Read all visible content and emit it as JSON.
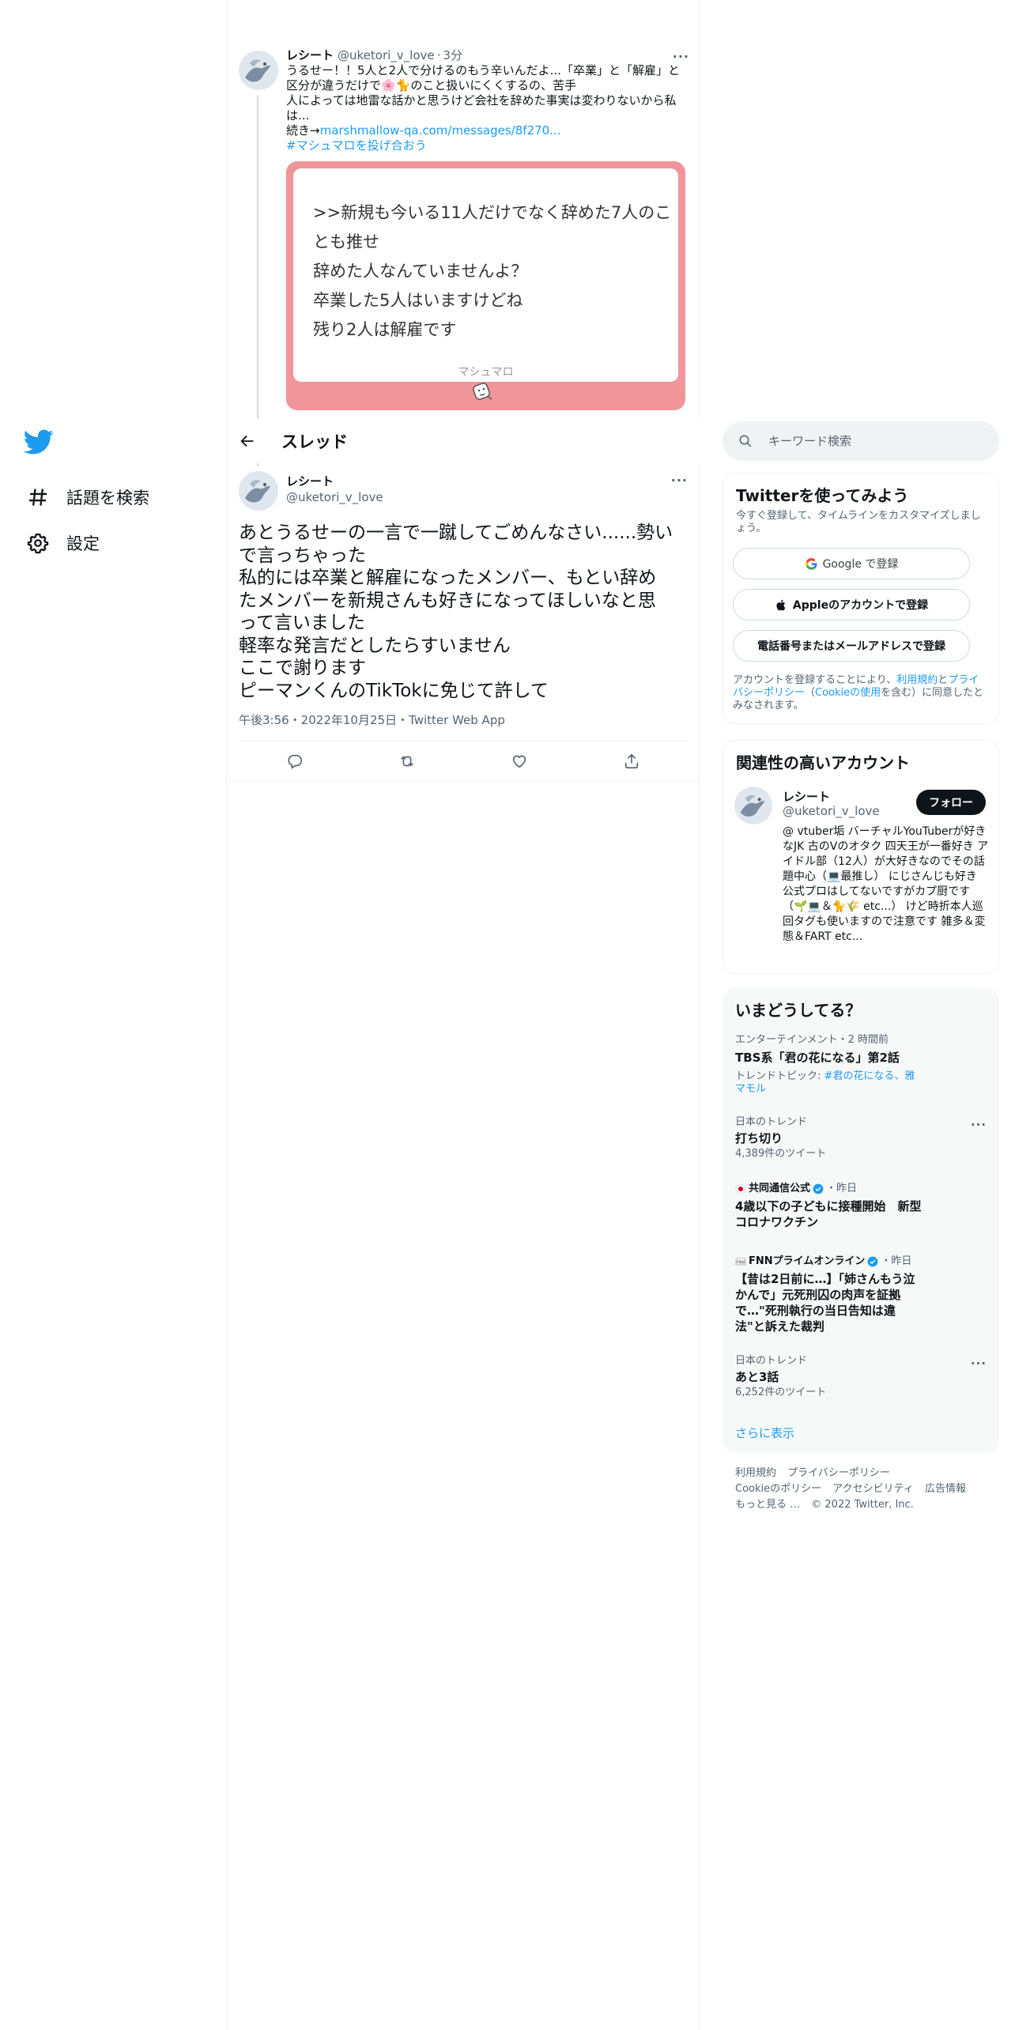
{
  "nav": {
    "items": [
      {
        "label": "話題を検索",
        "icon": "hashtag-icon"
      },
      {
        "label": "設定",
        "icon": "gear-icon"
      }
    ]
  },
  "prev_tweet": {
    "name": "レシート",
    "handle": "@uketori_v_love",
    "time": "3分",
    "text_lines": [
      "うるせー！！5人と2人で分けるのもう辛いんだよ...「卒業」と「解雇」と",
      "区分が違うだけで🌸🐈のこと扱いにくくするの、苦手",
      "人によっては地雷な話かと思うけど会社を辞めた事実は変わりないから私",
      "は..."
    ],
    "link_prefix": "続き→",
    "link": "marshmallow-qa.com/messages/8f270...",
    "hashtag": "#マシュマロを投げ合おう",
    "card": {
      "lines": [
        ">>新規も今いる11人だけでなく辞めた7人のこ",
        "とも推せ",
        "辞めた人なんていませんよ？",
        "卒業した5人はいますけどね",
        "残り2人は解雇です"
      ],
      "footer": "マシュマロ"
    }
  },
  "thread_header": {
    "title": "スレッド"
  },
  "main_tweet": {
    "name": "レシート",
    "handle": "@uketori_v_love",
    "text_lines": [
      "あとうるせーの一言で一蹴してごめんなさい......勢い",
      "で言っちゃった",
      "私的には卒業と解雇になったメンバー、もとい辞め",
      "たメンバーを新規さんも好きになってほしいなと思",
      "って言いました",
      "軽率な発言だとしたらすいません",
      "ここで謝ります",
      "ピーマンくんのTikTokに免じて許して"
    ],
    "meta": "午後3:56・2022年10月25日・Twitter Web App",
    "actions": [
      "reply-icon",
      "retweet-icon",
      "like-icon",
      "share-icon"
    ]
  },
  "search": {
    "placeholder": "キーワード検索"
  },
  "signup": {
    "title": "Twitterを使ってみよう",
    "subtitle": "今すぐ登録して、タイムラインをカスタマイズしましょう。",
    "google": "Google で登録",
    "apple": "Appleのアカウントで登録",
    "phone": "電話番号またはメールアドレスで登録",
    "legal_a": "アカウントを登録することにより、",
    "legal_terms": "利用規約",
    "legal_b": "と",
    "legal_privacy": "プライバシーポリシー",
    "legal_c": "（",
    "legal_cookie": "Cookieの使用",
    "legal_d": "を含む）に同意したとみなされます。"
  },
  "related": {
    "title": "関連性の高いアカウント",
    "name": "レシート",
    "handle": "@uketori_v_love",
    "follow": "フォロー",
    "bio": "@ vtuber垢 バーチャルYouTuberが好きなJK 古のVのオタク 四天王が一番好き アイドル部（12人）が大好きなのでその話題中心（💻最推し） にじさんじも好き 公式プロはしてないですがカプ厨です（🌱💻＆🐈🌾 etc...） けど時折本人巡回タグも使いますので注意です 雑多＆変態＆FART etc..."
  },
  "trends": {
    "title": "いまどうしてる？",
    "items": [
      {
        "context": "エンターテインメント・2 時間前",
        "title": "TBS系「君の花になる」第2話",
        "meta_prefix": "トレンドトピック: ",
        "meta_link": "#君の花になる、雅マモル"
      },
      {
        "context": "日本のトレンド",
        "title": "打ち切り",
        "meta": "4,389件のツイート"
      },
      {
        "source": "共同通信公式",
        "time": "・昨日",
        "title": "4歳以下の子どもに接種開始　新型コロナワクチン"
      },
      {
        "source": "FNNプライムオンライン",
        "time": "・昨日",
        "title": "【昔は2日前に…】「姉さんもう泣かんで」元死刑囚の肉声を証拠で…\"死刑執行の当日告知は違法\"と訴えた裁判"
      },
      {
        "context": "日本のトレンド",
        "title": "あと3話",
        "meta": "6,252件のツイート"
      }
    ],
    "show_more": "さらに表示"
  },
  "footer": {
    "links": [
      "利用規約",
      "プライバシーポリシー",
      "Cookieのポリシー",
      "アクセシビリティ",
      "広告情報",
      "もっと見る …"
    ],
    "copyright": "© 2022 Twitter, Inc."
  },
  "colors": {
    "accent": "#1d9bf0",
    "text": "#0f1419",
    "muted": "#536471",
    "card": "#f0959a"
  }
}
